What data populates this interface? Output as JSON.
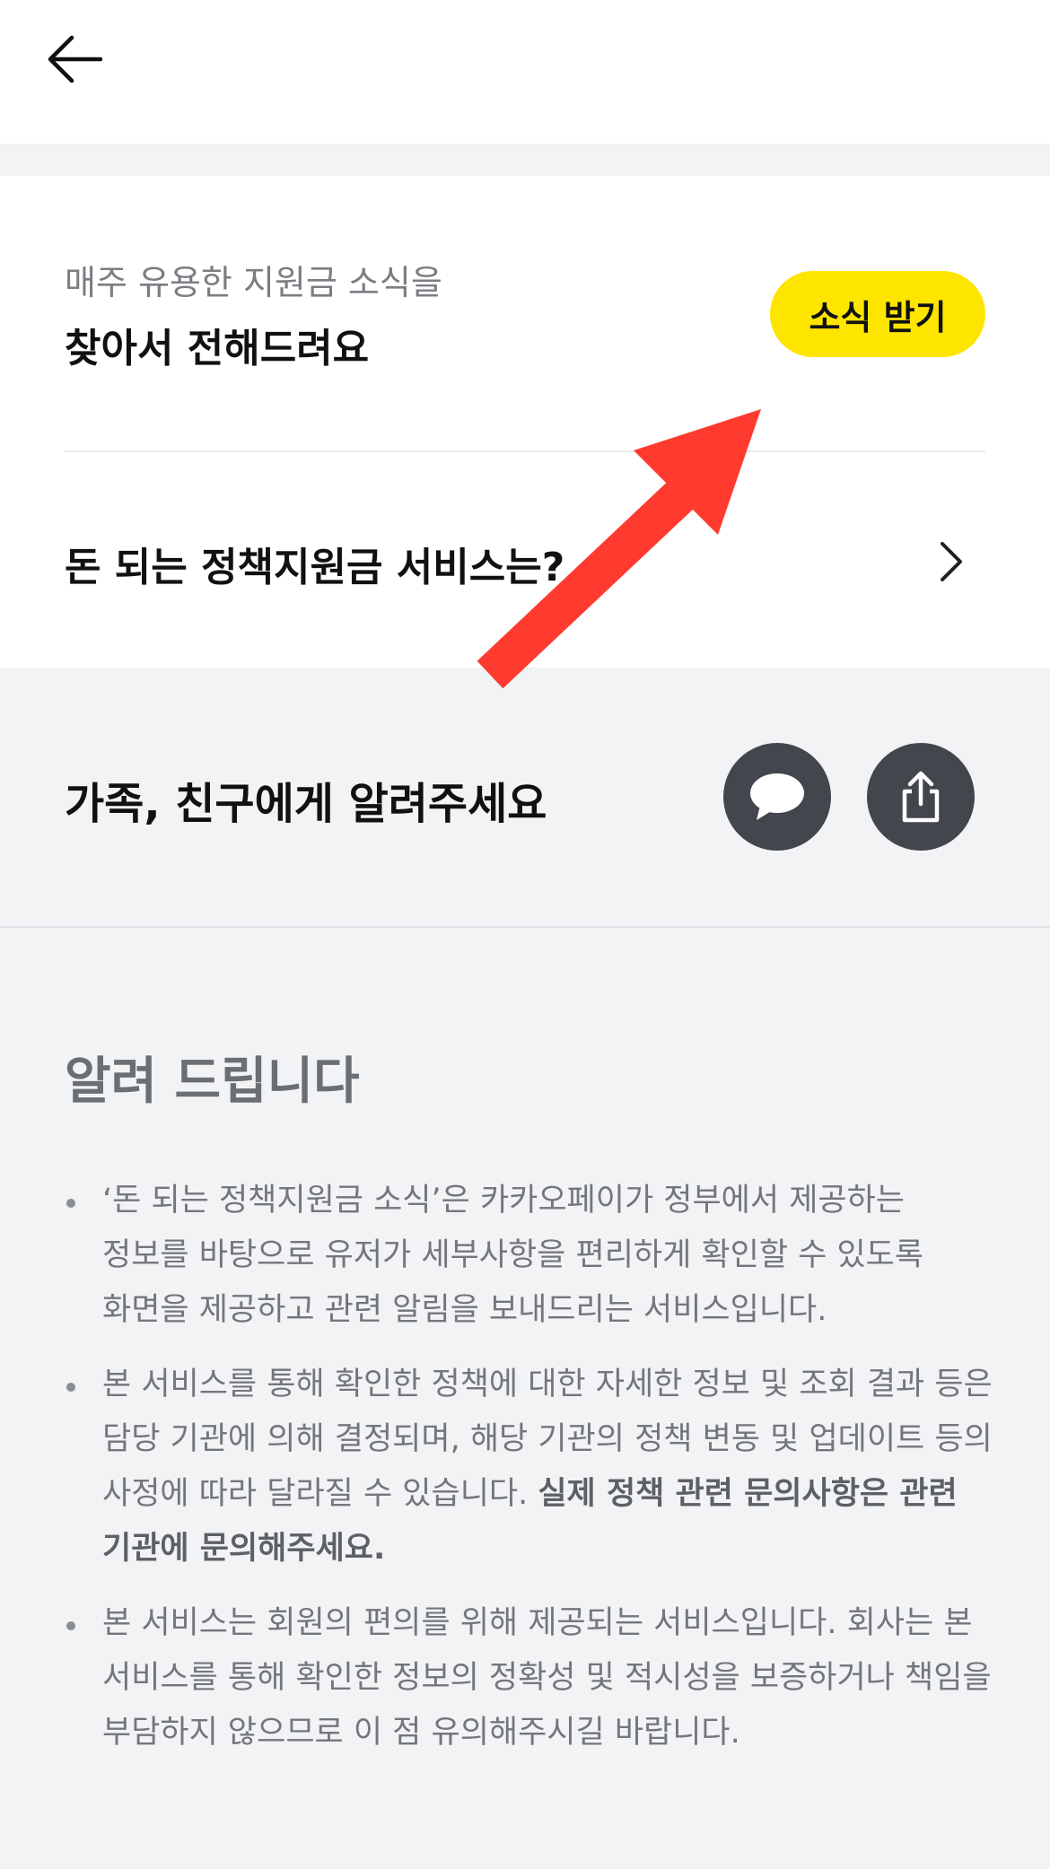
{
  "header": {
    "back_icon": "arrow-left-icon"
  },
  "news_card": {
    "subtitle": "매주 유용한 지원금 소식을",
    "title": "찾아서 전해드려요",
    "subscribe_label": "소식 받기",
    "subscribe_color": "#fee500"
  },
  "service_link": {
    "label": "돈 되는 정책지원금 서비스는?",
    "icon": "chevron-right-icon"
  },
  "share": {
    "title": "가족, 친구에게 알려주세요",
    "kakaotalk_icon": "speech-bubble-icon",
    "share_icon": "share-upload-icon",
    "button_color": "#43464d"
  },
  "notice": {
    "title": "알려 드립니다",
    "items": [
      {
        "text": "‘돈 되는 정책지원금 소식’은 카카오페이가 정부에서 제공하는 정보를 바탕으로 유저가 세부사항을 편리하게 확인할 수 있도록 화면을 제공하고 관련 알림을 보내드리는 서비스입니다.",
        "bold": ""
      },
      {
        "text": "본 서비스를 통해 확인한 정책에 대한 자세한 정보 및 조회 결과 등은 담당 기관에 의해 결정되며, 해당 기관의 정책 변동 및 업데이트 등의 사정에 따라 달라질 수 있습니다. ",
        "bold": "실제 정책 관련 문의사항은 관련 기관에 문의해주세요."
      },
      {
        "text": "본 서비스는 회원의 편의를 위해 제공되는 서비스입니다. 회사는 본 서비스를 통해 확인한 정보의 정확성 및 적시성을 보증하거나 책임을 부담하지 않으므로 이 점 유의해주시길 바랍니다.",
        "bold": ""
      }
    ]
  },
  "annotation": {
    "arrow_color": "#ff3b30"
  }
}
